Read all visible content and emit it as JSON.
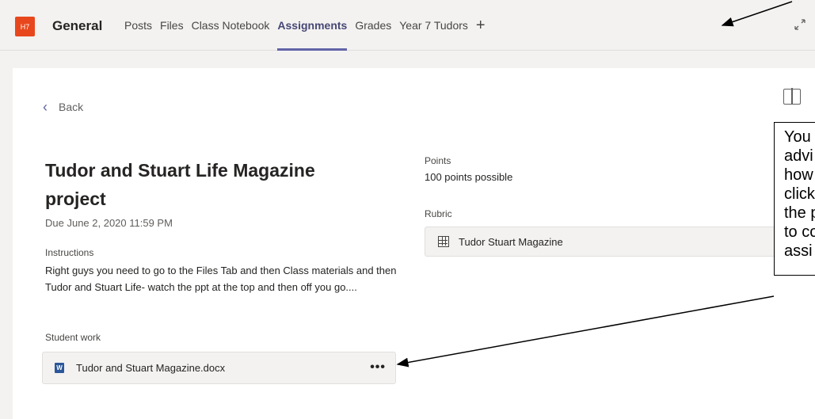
{
  "header": {
    "team_avatar": "H7",
    "channel_name": "General",
    "tabs": [
      {
        "label": "Posts"
      },
      {
        "label": "Files"
      },
      {
        "label": "Class Notebook"
      },
      {
        "label": "Assignments",
        "active": true
      },
      {
        "label": "Grades"
      },
      {
        "label": "Year 7 Tudors"
      }
    ],
    "add_tab_symbol": "+",
    "expand_icon": "expand-icon"
  },
  "assignment": {
    "back_label": "Back",
    "title": "Tudor and Stuart Life Magazine project",
    "due": "Due June 2, 2020 11:59 PM",
    "instructions_label": "Instructions",
    "instructions_text": "Right guys you need to go to the Files Tab and then Class materials and then Tudor and Stuart Life- watch the ppt at the top and then off you go....",
    "student_work_label": "Student work",
    "file_name": "Tudor and Stuart Magazine.docx",
    "points_label": "Points",
    "points_value": "100 points possible",
    "rubric_label": "Rubric",
    "rubric_name": "Tudor Stuart Magazine"
  },
  "annotation": {
    "lines": [
      "You",
      "advi",
      "how",
      "click",
      "the p",
      "to co",
      "assi"
    ]
  },
  "colors": {
    "accent": "#6264a7",
    "team_avatar_bg": "#e8471d",
    "word_blue": "#2b579a"
  }
}
